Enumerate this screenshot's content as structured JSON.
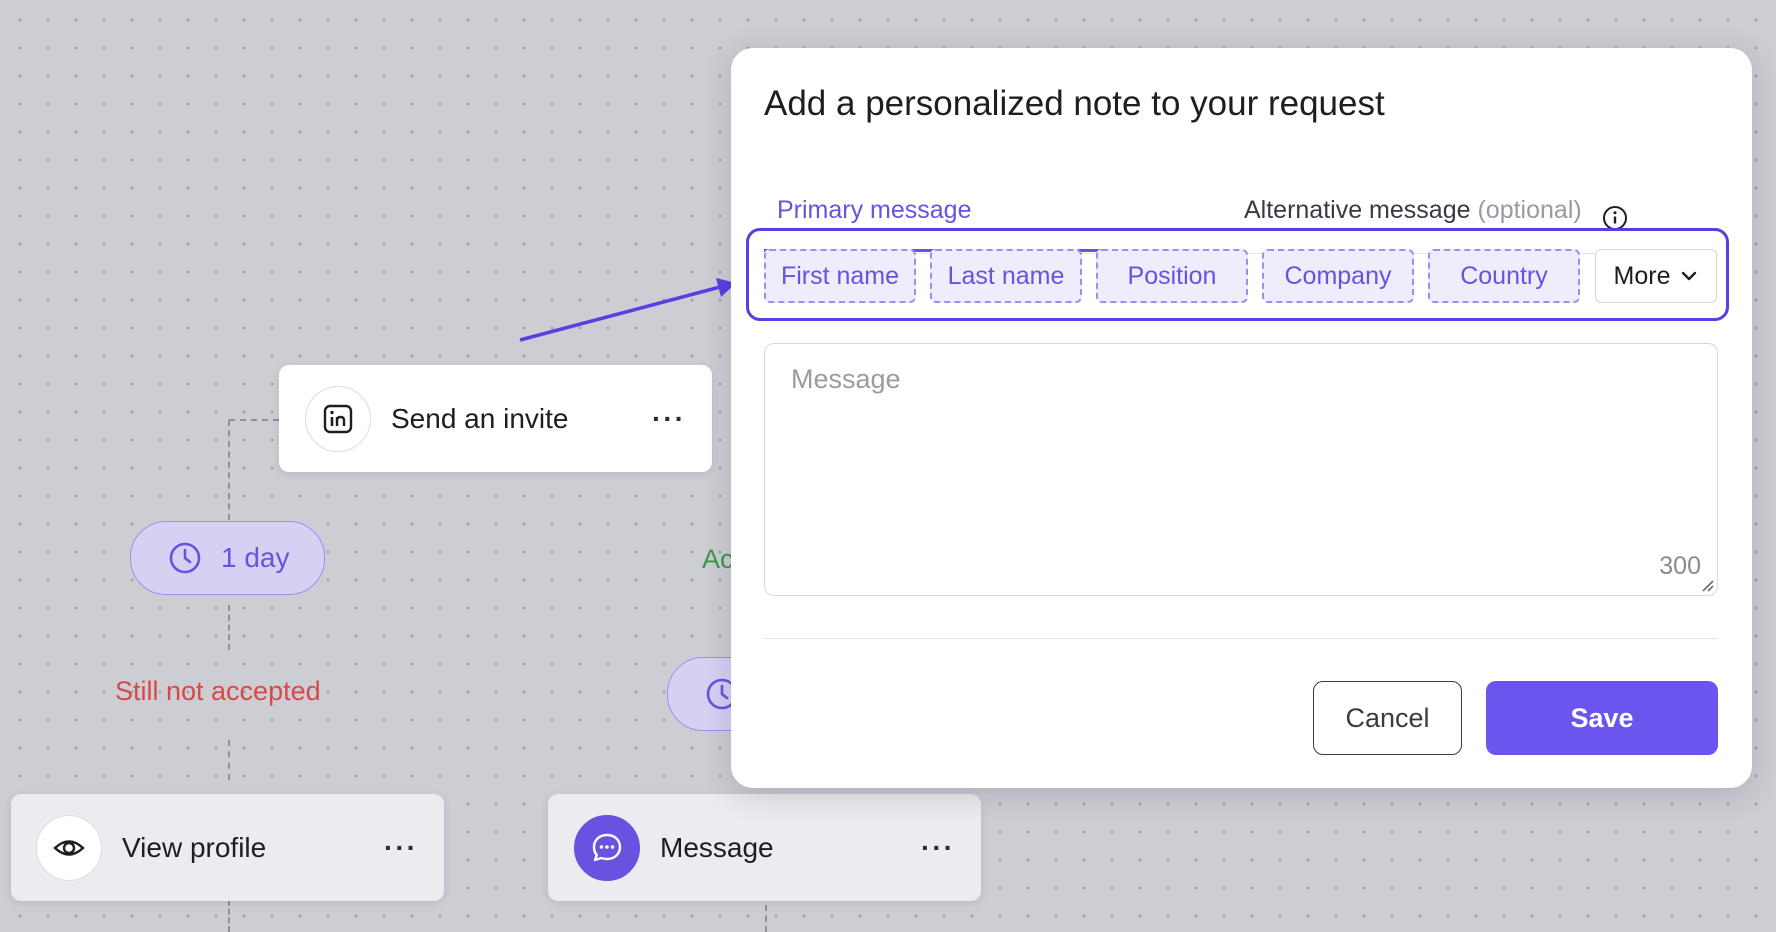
{
  "canvas": {
    "flow_nodes": {
      "send_invite": {
        "label": "Send an invite",
        "more": "···",
        "icon": "linkedin-icon"
      },
      "view_profile": {
        "label": "View profile",
        "more": "···",
        "icon": "eye-icon"
      },
      "message": {
        "label": "Message",
        "more": "···",
        "icon": "chat-bubble-icon"
      }
    },
    "delay_pill": {
      "label": "1 day",
      "icon": "clock-icon"
    },
    "status": {
      "not_accepted": "Still not accepted",
      "accepted_partial": "Ac"
    },
    "colors": {
      "accent": "#6a52e0",
      "not_accepted": "#d94848",
      "accepted": "#3c9a4a"
    }
  },
  "modal": {
    "title": "Add a personalized note to your request",
    "tabs": {
      "primary": "Primary message",
      "alternative": "Alternative message",
      "alternative_suffix": "(optional)"
    },
    "variables": [
      "First name",
      "Last name",
      "Position",
      "Company",
      "Country"
    ],
    "more_label": "More",
    "message": {
      "placeholder": "Message",
      "char_limit": "300"
    },
    "buttons": {
      "cancel": "Cancel",
      "save": "Save"
    }
  }
}
